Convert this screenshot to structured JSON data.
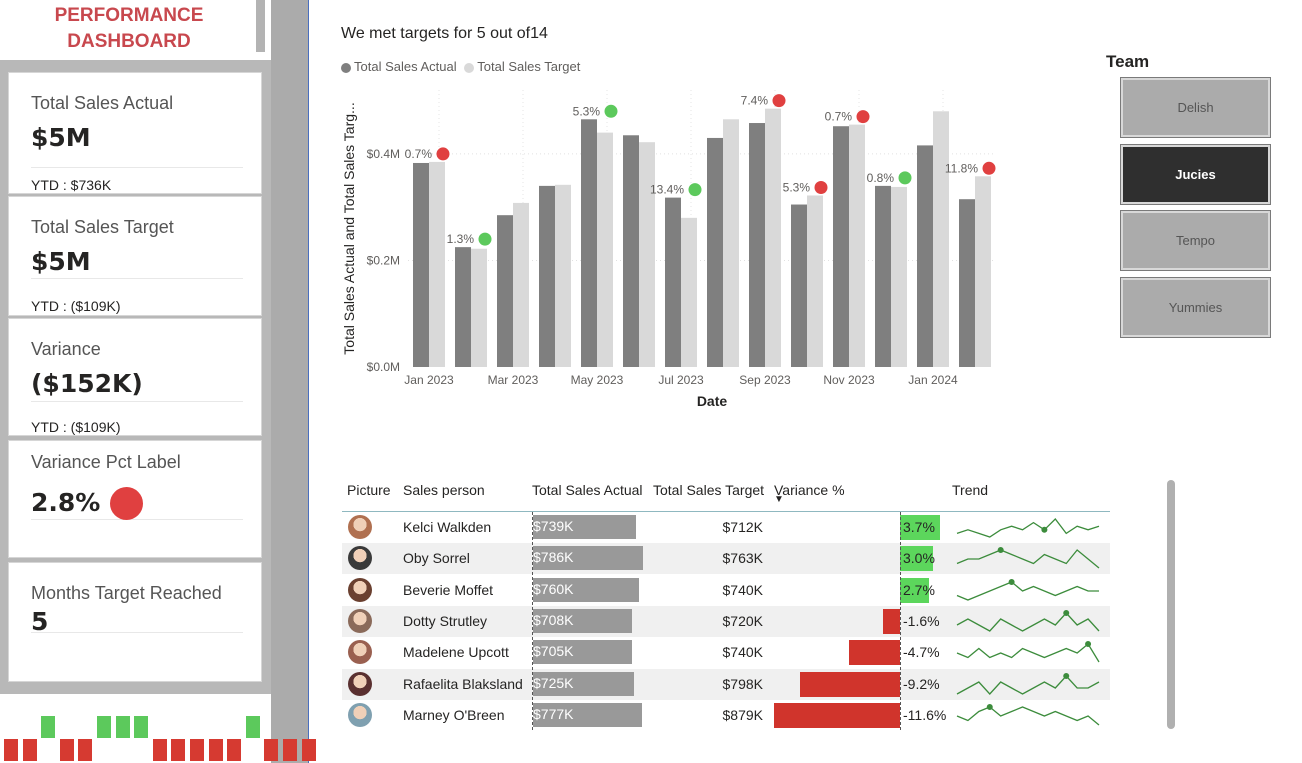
{
  "dashboard": {
    "title_line1": "PERFORMANCE",
    "title_line2": "DASHBOARD"
  },
  "cards": {
    "total_sales_actual": {
      "label": "Total Sales Actual",
      "value": "$5M",
      "ytd": "YTD : $736K"
    },
    "total_sales_target": {
      "label": "Total Sales Target",
      "value": "$5M",
      "ytd": "YTD : ($109K)"
    },
    "variance": {
      "label": "Variance",
      "value": "($152K)",
      "ytd": "YTD : ($109K)"
    },
    "variance_pct": {
      "label": "Variance Pct Label",
      "value": "2.8%",
      "status_color": "#e04040"
    },
    "months_target": {
      "label": "Months Target Reached",
      "value": "5"
    }
  },
  "month_indicators": [
    "red",
    "red",
    "green",
    "red",
    "red",
    "green",
    "green",
    "green",
    "red",
    "red",
    "red",
    "red",
    "red",
    "green",
    "red",
    "red",
    "red"
  ],
  "colors": {
    "accent_red": "#e04040",
    "accent_green": "#5cc95c",
    "bar_actual": "#7f7f7f",
    "bar_target": "#d9d9d9",
    "title_red": "#c8484e"
  },
  "chart_data": {
    "type": "bar",
    "title": "We met targets for 5 out of14",
    "xlabel": "Date",
    "ylabel": "Total Sales Actual and Total Sales Targ...",
    "ylim": [
      0,
      0.52
    ],
    "yticks": [
      "$0.0M",
      "$0.2M",
      "$0.4M"
    ],
    "ytick_values": [
      0,
      0.2,
      0.4
    ],
    "xtick_labels": [
      "Jan 2023",
      "Mar 2023",
      "May 2023",
      "Jul 2023",
      "Sep 2023",
      "Nov 2023",
      "Jan 2024"
    ],
    "series": [
      {
        "name": "Total Sales Actual",
        "values": [
          0.383,
          0.225,
          0.285,
          0.34,
          0.465,
          0.435,
          0.318,
          0.43,
          0.458,
          0.305,
          0.452,
          0.34,
          0.416,
          0.315
        ]
      },
      {
        "name": "Total Sales Target",
        "values": [
          0.385,
          0.222,
          0.308,
          0.342,
          0.44,
          0.422,
          0.28,
          0.465,
          0.485,
          0.322,
          0.455,
          0.338,
          0.48,
          0.358
        ]
      }
    ],
    "annotations": [
      {
        "index": 0,
        "label": "0.7%",
        "status": "red"
      },
      {
        "index": 1,
        "label": "1.3%",
        "status": "green"
      },
      {
        "index": 4,
        "label": "5.3%",
        "status": "green"
      },
      {
        "index": 6,
        "label": "13.4%",
        "status": "green"
      },
      {
        "index": 8,
        "label": "7.4%",
        "status": "red"
      },
      {
        "index": 9,
        "label": "5.3%",
        "status": "red"
      },
      {
        "index": 10,
        "label": "0.7%",
        "status": "red"
      },
      {
        "index": 11,
        "label": "0.8%",
        "status": "green"
      },
      {
        "index": 13,
        "label": "11.8%",
        "status": "red"
      }
    ]
  },
  "team": {
    "title": "Team",
    "options": [
      "Delish",
      "Jucies",
      "Tempo",
      "Yummies"
    ],
    "selected": "Jucies"
  },
  "table": {
    "headers": [
      "Picture",
      "Sales person",
      "Total Sales Actual",
      "Total Sales Target",
      "Variance %",
      "Trend"
    ],
    "rows": [
      {
        "name": "Kelci Walkden",
        "actual": "$739K",
        "actual_value": 739,
        "target": "$712K",
        "variance": "3.7%",
        "variance_value": 3.7,
        "avatar_color": "#b07050",
        "trend": [
          3,
          4,
          3,
          2,
          4,
          5,
          4,
          6,
          4,
          7,
          3,
          5,
          4,
          5
        ],
        "trend_peak": 8
      },
      {
        "name": "Oby Sorrel",
        "actual": "$786K",
        "actual_value": 786,
        "target": "$763K",
        "variance": "3.0%",
        "variance_value": 3.0,
        "avatar_color": "#3a3a3a",
        "trend": [
          3,
          4,
          4,
          5,
          6,
          5,
          4,
          3,
          5,
          4,
          3,
          6,
          4,
          2
        ],
        "trend_peak": 4
      },
      {
        "name": "Beverie Moffet",
        "actual": "$760K",
        "actual_value": 760,
        "target": "$740K",
        "variance": "2.7%",
        "variance_value": 2.7,
        "avatar_color": "#6a4030",
        "trend": [
          3,
          2,
          3,
          4,
          5,
          6,
          4,
          5,
          4,
          3,
          4,
          5,
          4,
          4
        ],
        "trend_peak": 5
      },
      {
        "name": "Dotty Strutley",
        "actual": "$708K",
        "actual_value": 708,
        "target": "$720K",
        "variance": "-1.6%",
        "variance_value": -1.6,
        "avatar_color": "#8a6a5a",
        "trend": [
          4,
          5,
          4,
          3,
          5,
          4,
          3,
          4,
          5,
          4,
          6,
          4,
          5,
          3
        ],
        "trend_peak": 10
      },
      {
        "name": "Madelene Upcott",
        "actual": "$705K",
        "actual_value": 705,
        "target": "$740K",
        "variance": "-4.7%",
        "variance_value": -4.7,
        "avatar_color": "#9a6050",
        "trend": [
          4,
          3,
          5,
          3,
          4,
          3,
          5,
          4,
          3,
          4,
          5,
          4,
          6,
          2
        ],
        "trend_peak": 12
      },
      {
        "name": "Rafaelita Blaksland",
        "actual": "$725K",
        "actual_value": 725,
        "target": "$798K",
        "variance": "-9.2%",
        "variance_value": -9.2,
        "avatar_color": "#5a3030",
        "trend": [
          3,
          4,
          5,
          3,
          5,
          4,
          3,
          4,
          5,
          4,
          6,
          4,
          4,
          5
        ],
        "trend_peak": 10
      },
      {
        "name": "Marney O'Breen",
        "actual": "$777K",
        "actual_value": 777,
        "target": "$879K",
        "variance": "-11.6%",
        "variance_value": -11.6,
        "avatar_color": "#7fa0b0",
        "trend": [
          4,
          3,
          5,
          6,
          4,
          5,
          6,
          5,
          4,
          5,
          4,
          3,
          4,
          2
        ],
        "trend_peak": 3
      }
    ]
  }
}
